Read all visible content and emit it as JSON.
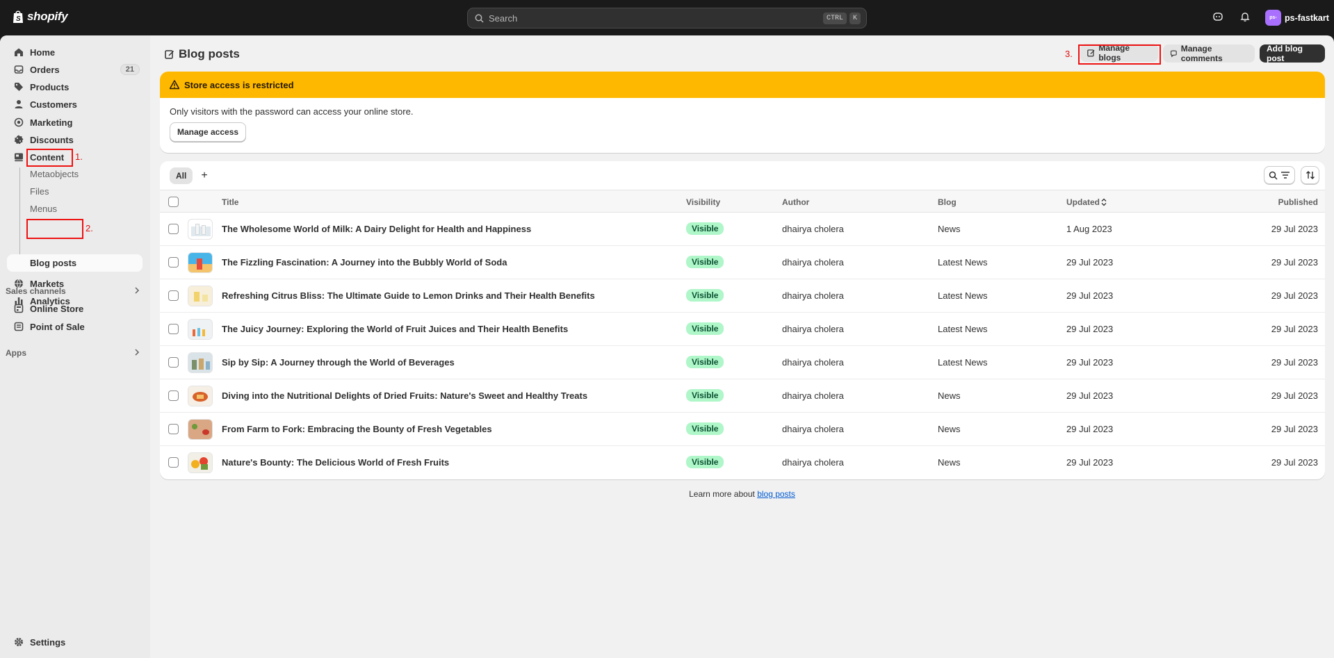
{
  "topbar": {
    "logo_text": "shopify",
    "search_placeholder": "Search",
    "kbd_ctrl": "CTRL",
    "kbd_k": "K",
    "avatar_initials": "ps-",
    "store_name": "ps-fastkart"
  },
  "sidebar": {
    "items": [
      {
        "label": "Home",
        "icon": "home-icon"
      },
      {
        "label": "Orders",
        "icon": "orders-icon",
        "badge": "21"
      },
      {
        "label": "Products",
        "icon": "tag-icon"
      },
      {
        "label": "Customers",
        "icon": "person-icon"
      },
      {
        "label": "Marketing",
        "icon": "target-icon"
      },
      {
        "label": "Discounts",
        "icon": "discount-icon"
      },
      {
        "label": "Content",
        "icon": "content-icon"
      }
    ],
    "sub_items": [
      "Metaobjects",
      "Files",
      "Menus",
      "Blog posts"
    ],
    "items_after": [
      {
        "label": "Markets",
        "icon": "globe-icon"
      },
      {
        "label": "Analytics",
        "icon": "chart-icon"
      }
    ],
    "sales_channels_title": "Sales channels",
    "sales_channels": [
      {
        "label": "Online Store",
        "icon": "store-icon"
      },
      {
        "label": "Point of Sale",
        "icon": "pos-icon"
      }
    ],
    "apps_title": "Apps",
    "settings_label": "Settings"
  },
  "annotations": [
    "1.",
    "2.",
    "3."
  ],
  "header": {
    "title": "Blog posts",
    "manage_blogs": "Manage blogs",
    "manage_comments": "Manage comments",
    "add_blog_post": "Add blog post"
  },
  "banner": {
    "title": "Store access is restricted",
    "body": "Only visitors with the password can access your online store.",
    "button": "Manage access"
  },
  "table": {
    "tab_all": "All",
    "columns": {
      "title": "Title",
      "visibility": "Visibility",
      "author": "Author",
      "blog": "Blog",
      "updated": "Updated",
      "published": "Published"
    },
    "rows": [
      {
        "title": "The Wholesome World of Milk: A Dairy Delight for Health and Happiness",
        "visibility": "Visible",
        "author": "dhairya cholera",
        "blog": "News",
        "updated": "1 Aug 2023",
        "published": "29 Jul 2023"
      },
      {
        "title": "The Fizzling Fascination: A Journey into the Bubbly World of Soda",
        "visibility": "Visible",
        "author": "dhairya cholera",
        "blog": "Latest News",
        "updated": "29 Jul 2023",
        "published": "29 Jul 2023"
      },
      {
        "title": "Refreshing Citrus Bliss: The Ultimate Guide to Lemon Drinks and Their Health Benefits",
        "visibility": "Visible",
        "author": "dhairya cholera",
        "blog": "Latest News",
        "updated": "29 Jul 2023",
        "published": "29 Jul 2023"
      },
      {
        "title": "The Juicy Journey: Exploring the World of Fruit Juices and Their Health Benefits",
        "visibility": "Visible",
        "author": "dhairya cholera",
        "blog": "Latest News",
        "updated": "29 Jul 2023",
        "published": "29 Jul 2023"
      },
      {
        "title": "Sip by Sip: A Journey through the World of Beverages",
        "visibility": "Visible",
        "author": "dhairya cholera",
        "blog": "Latest News",
        "updated": "29 Jul 2023",
        "published": "29 Jul 2023"
      },
      {
        "title": "Diving into the Nutritional Delights of Dried Fruits: Nature's Sweet and Healthy Treats",
        "visibility": "Visible",
        "author": "dhairya cholera",
        "blog": "News",
        "updated": "29 Jul 2023",
        "published": "29 Jul 2023"
      },
      {
        "title": "From Farm to Fork: Embracing the Bounty of Fresh Vegetables",
        "visibility": "Visible",
        "author": "dhairya cholera",
        "blog": "News",
        "updated": "29 Jul 2023",
        "published": "29 Jul 2023"
      },
      {
        "title": "Nature's Bounty: The Delicious World of Fresh Fruits",
        "visibility": "Visible",
        "author": "dhairya cholera",
        "blog": "News",
        "updated": "29 Jul 2023",
        "published": "29 Jul 2023"
      }
    ]
  },
  "footer": {
    "text": "Learn more about",
    "link": "blog posts"
  },
  "colors": {
    "topbar": "#1a1a1a",
    "banner": "#ffb800",
    "visible_badge": "#aff6c9",
    "annotation": "#e11111",
    "avatar": "#a970ff"
  }
}
